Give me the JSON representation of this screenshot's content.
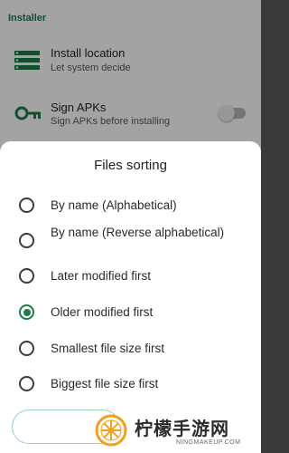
{
  "background": {
    "section_title": "Installer",
    "rows": [
      {
        "title": "Install location",
        "subtitle": "Let system decide",
        "icon": "storage-icon"
      },
      {
        "title": "Sign APKs",
        "subtitle": "Sign APKs before installing",
        "icon": "key-icon",
        "toggle": false
      }
    ]
  },
  "dialog": {
    "title": "Files sorting",
    "options": [
      {
        "label": "By name (Alphabetical)",
        "checked": false
      },
      {
        "label": "By name (Reverse alphabetical)",
        "checked": false
      },
      {
        "label": "Later modified first",
        "checked": false
      },
      {
        "label": "Older modified first",
        "checked": true
      },
      {
        "label": "Smallest file size first",
        "checked": false
      },
      {
        "label": "Biggest file size first",
        "checked": false
      }
    ]
  },
  "watermark": {
    "text": "柠檬手游网",
    "url": "NINGMAKEUP.COM"
  },
  "colors": {
    "accent": "#1e7a4a",
    "scrim": "rgba(0,0,0,0.36)"
  }
}
